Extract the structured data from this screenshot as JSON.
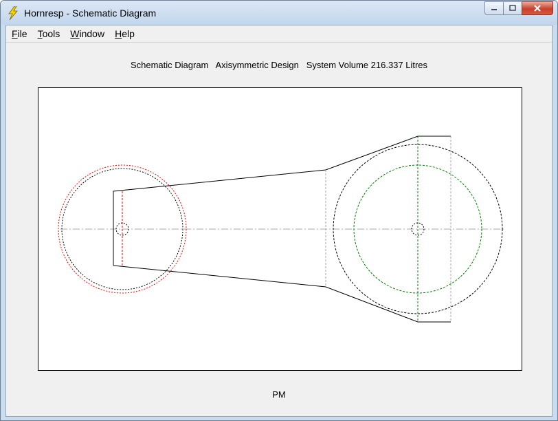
{
  "window": {
    "title": "Hornresp - Schematic Diagram",
    "icon": "lightning-icon"
  },
  "menu": {
    "items": [
      {
        "label": "File",
        "name": "menu-file"
      },
      {
        "label": "Tools",
        "name": "menu-tools"
      },
      {
        "label": "Window",
        "name": "menu-window"
      },
      {
        "label": "Help",
        "name": "menu-help"
      }
    ]
  },
  "header": {
    "diagram_label": "Schematic Diagram",
    "design_label": "Axisymmetric Design",
    "volume_label": "System Volume 216.337 Litres"
  },
  "footer": {
    "label": "PM"
  },
  "colors": {
    "accent_red": "#ff0000",
    "accent_green": "#008000",
    "outline": "#000000",
    "guide": "#aaaaaa",
    "close_button": "#c8412b"
  }
}
